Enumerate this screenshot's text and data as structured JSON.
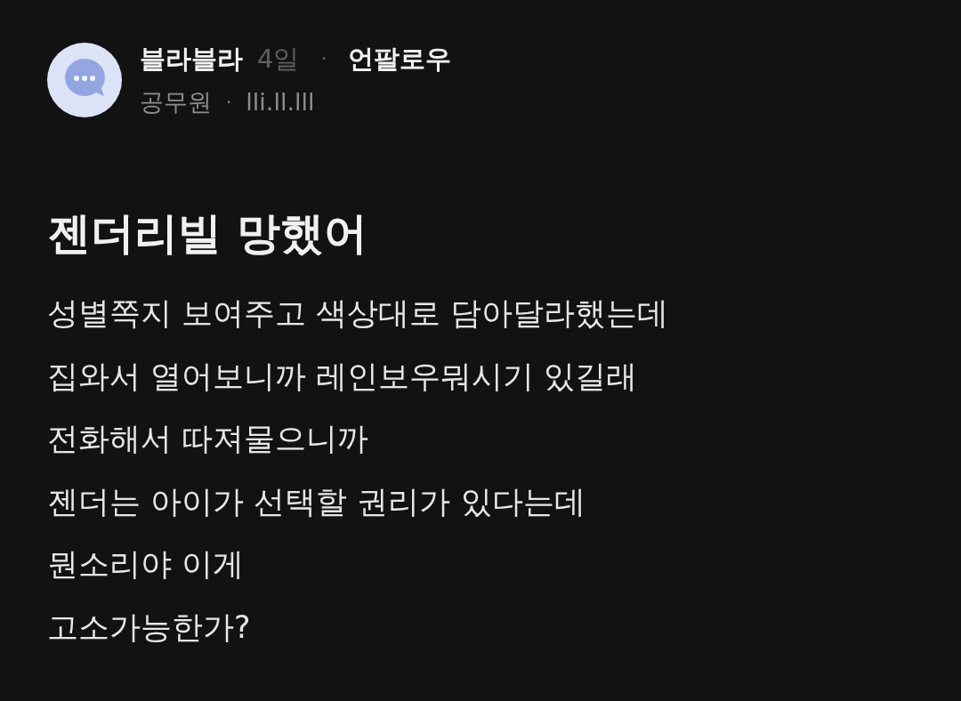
{
  "post": {
    "author": {
      "name": "블라블라",
      "time": "4일",
      "separator": "·",
      "follow_button": "언팔로우",
      "job": "공무원",
      "meta_separator": "·",
      "company": "lli.ll.lll"
    },
    "title": "젠더리빌 망했어",
    "body_lines": [
      "성별쪽지 보여주고 색상대로 담아달라했는데",
      "집와서 열어보니까 레인보우뭐시기 있길래",
      "전화해서 따져물으니까",
      "젠더는 아이가 선택할 권리가 있다는데",
      "뭔소리야 이게",
      "고소가능한가?"
    ]
  }
}
